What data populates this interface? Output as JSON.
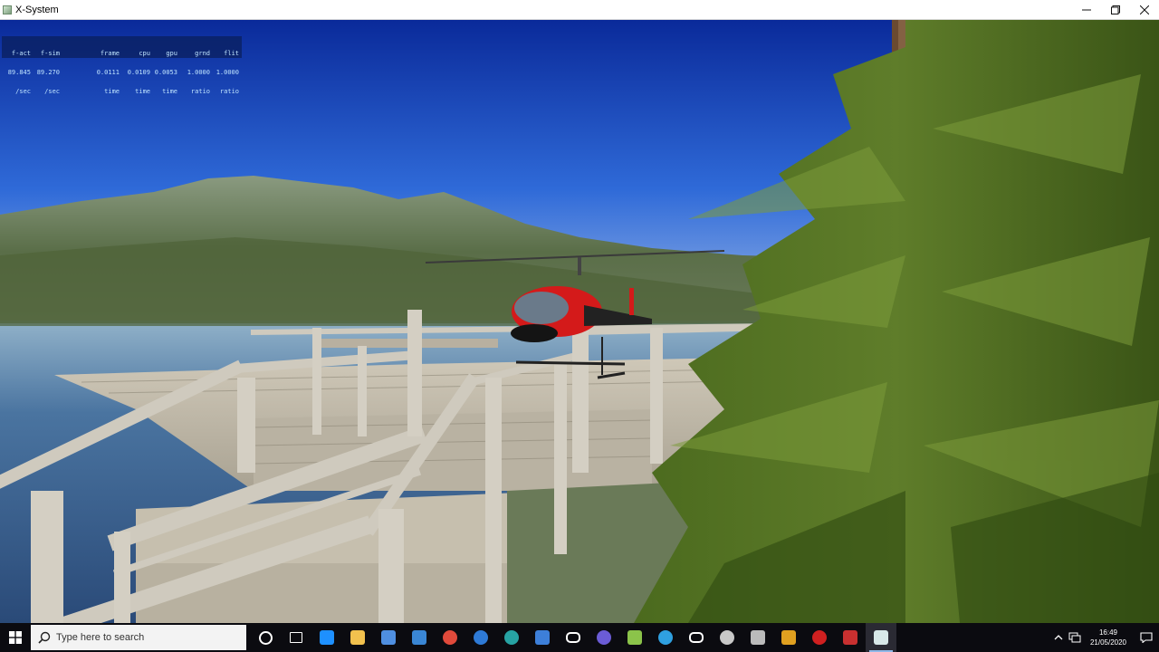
{
  "window": {
    "title": "X-System",
    "minimize_icon": "minimize-icon",
    "maximize_icon": "maximize-icon",
    "close_icon": "close-icon"
  },
  "stats": {
    "columns": [
      {
        "header": "f-act",
        "value": "89.845",
        "unit": "/sec"
      },
      {
        "header": "f-sim",
        "value": "89.270",
        "unit": "/sec"
      },
      {
        "header": "frame",
        "value": "0.0111",
        "unit": "time"
      },
      {
        "header": "cpu",
        "value": "0.0109",
        "unit": "time"
      },
      {
        "header": "gpu",
        "value": "0.0053",
        "unit": "time"
      },
      {
        "header": "grnd",
        "value": "1.0000",
        "unit": "ratio"
      },
      {
        "header": "flit",
        "value": "1.0000",
        "unit": "ratio"
      }
    ]
  },
  "taskbar": {
    "search_placeholder": "Type here to search",
    "apps": [
      {
        "name": "cortana-icon",
        "color": "#ffffff"
      },
      {
        "name": "task-view-icon",
        "color": "#ffffff"
      },
      {
        "name": "edge-icon",
        "color": "#1e90ff"
      },
      {
        "name": "file-explorer-icon",
        "color": "#f2c14e"
      },
      {
        "name": "store-icon",
        "color": "#4f8fe0"
      },
      {
        "name": "mail-icon",
        "color": "#3a86d4"
      },
      {
        "name": "chrome-icon",
        "color": "#e14a3b"
      },
      {
        "name": "ccleaner-icon",
        "color": "#2e7ad6"
      },
      {
        "name": "uplay-icon",
        "color": "#27a3a3"
      },
      {
        "name": "blue-window-icon",
        "color": "#3d7fd9"
      },
      {
        "name": "oculus-icon",
        "color": "#ffffff"
      },
      {
        "name": "obs-icon",
        "color": "#6b5cd6"
      },
      {
        "name": "notepad-icon",
        "color": "#8bc34a"
      },
      {
        "name": "globe-app-icon",
        "color": "#2fa0e0"
      },
      {
        "name": "oculus-2-icon",
        "color": "#ffffff"
      },
      {
        "name": "steam-icon",
        "color": "#c8c8c8"
      },
      {
        "name": "plane-icon",
        "color": "#bbbbbb"
      },
      {
        "name": "star-app-icon",
        "color": "#e0a020"
      },
      {
        "name": "red-app-icon",
        "color": "#d02020"
      },
      {
        "name": "car-app-icon",
        "color": "#c83030"
      },
      {
        "name": "x-plane-icon",
        "color": "#d8e8e8",
        "active": true
      }
    ],
    "tray": {
      "time": "16:49",
      "date": "21/05/2020"
    }
  }
}
